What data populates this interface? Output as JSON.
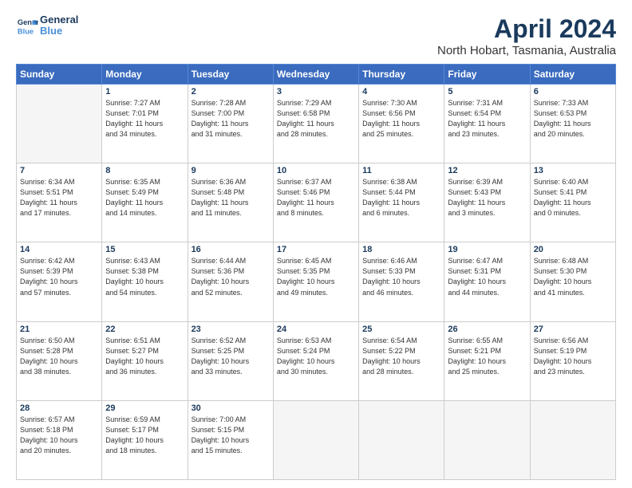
{
  "header": {
    "logo_line1": "General",
    "logo_line2": "Blue",
    "title": "April 2024",
    "subtitle": "North Hobart, Tasmania, Australia"
  },
  "days_of_week": [
    "Sunday",
    "Monday",
    "Tuesday",
    "Wednesday",
    "Thursday",
    "Friday",
    "Saturday"
  ],
  "weeks": [
    [
      {
        "day": "",
        "info": ""
      },
      {
        "day": "1",
        "info": "Sunrise: 7:27 AM\nSunset: 7:01 PM\nDaylight: 11 hours\nand 34 minutes."
      },
      {
        "day": "2",
        "info": "Sunrise: 7:28 AM\nSunset: 7:00 PM\nDaylight: 11 hours\nand 31 minutes."
      },
      {
        "day": "3",
        "info": "Sunrise: 7:29 AM\nSunset: 6:58 PM\nDaylight: 11 hours\nand 28 minutes."
      },
      {
        "day": "4",
        "info": "Sunrise: 7:30 AM\nSunset: 6:56 PM\nDaylight: 11 hours\nand 25 minutes."
      },
      {
        "day": "5",
        "info": "Sunrise: 7:31 AM\nSunset: 6:54 PM\nDaylight: 11 hours\nand 23 minutes."
      },
      {
        "day": "6",
        "info": "Sunrise: 7:33 AM\nSunset: 6:53 PM\nDaylight: 11 hours\nand 20 minutes."
      }
    ],
    [
      {
        "day": "7",
        "info": "Sunrise: 6:34 AM\nSunset: 5:51 PM\nDaylight: 11 hours\nand 17 minutes."
      },
      {
        "day": "8",
        "info": "Sunrise: 6:35 AM\nSunset: 5:49 PM\nDaylight: 11 hours\nand 14 minutes."
      },
      {
        "day": "9",
        "info": "Sunrise: 6:36 AM\nSunset: 5:48 PM\nDaylight: 11 hours\nand 11 minutes."
      },
      {
        "day": "10",
        "info": "Sunrise: 6:37 AM\nSunset: 5:46 PM\nDaylight: 11 hours\nand 8 minutes."
      },
      {
        "day": "11",
        "info": "Sunrise: 6:38 AM\nSunset: 5:44 PM\nDaylight: 11 hours\nand 6 minutes."
      },
      {
        "day": "12",
        "info": "Sunrise: 6:39 AM\nSunset: 5:43 PM\nDaylight: 11 hours\nand 3 minutes."
      },
      {
        "day": "13",
        "info": "Sunrise: 6:40 AM\nSunset: 5:41 PM\nDaylight: 11 hours\nand 0 minutes."
      }
    ],
    [
      {
        "day": "14",
        "info": "Sunrise: 6:42 AM\nSunset: 5:39 PM\nDaylight: 10 hours\nand 57 minutes."
      },
      {
        "day": "15",
        "info": "Sunrise: 6:43 AM\nSunset: 5:38 PM\nDaylight: 10 hours\nand 54 minutes."
      },
      {
        "day": "16",
        "info": "Sunrise: 6:44 AM\nSunset: 5:36 PM\nDaylight: 10 hours\nand 52 minutes."
      },
      {
        "day": "17",
        "info": "Sunrise: 6:45 AM\nSunset: 5:35 PM\nDaylight: 10 hours\nand 49 minutes."
      },
      {
        "day": "18",
        "info": "Sunrise: 6:46 AM\nSunset: 5:33 PM\nDaylight: 10 hours\nand 46 minutes."
      },
      {
        "day": "19",
        "info": "Sunrise: 6:47 AM\nSunset: 5:31 PM\nDaylight: 10 hours\nand 44 minutes."
      },
      {
        "day": "20",
        "info": "Sunrise: 6:48 AM\nSunset: 5:30 PM\nDaylight: 10 hours\nand 41 minutes."
      }
    ],
    [
      {
        "day": "21",
        "info": "Sunrise: 6:50 AM\nSunset: 5:28 PM\nDaylight: 10 hours\nand 38 minutes."
      },
      {
        "day": "22",
        "info": "Sunrise: 6:51 AM\nSunset: 5:27 PM\nDaylight: 10 hours\nand 36 minutes."
      },
      {
        "day": "23",
        "info": "Sunrise: 6:52 AM\nSunset: 5:25 PM\nDaylight: 10 hours\nand 33 minutes."
      },
      {
        "day": "24",
        "info": "Sunrise: 6:53 AM\nSunset: 5:24 PM\nDaylight: 10 hours\nand 30 minutes."
      },
      {
        "day": "25",
        "info": "Sunrise: 6:54 AM\nSunset: 5:22 PM\nDaylight: 10 hours\nand 28 minutes."
      },
      {
        "day": "26",
        "info": "Sunrise: 6:55 AM\nSunset: 5:21 PM\nDaylight: 10 hours\nand 25 minutes."
      },
      {
        "day": "27",
        "info": "Sunrise: 6:56 AM\nSunset: 5:19 PM\nDaylight: 10 hours\nand 23 minutes."
      }
    ],
    [
      {
        "day": "28",
        "info": "Sunrise: 6:57 AM\nSunset: 5:18 PM\nDaylight: 10 hours\nand 20 minutes."
      },
      {
        "day": "29",
        "info": "Sunrise: 6:59 AM\nSunset: 5:17 PM\nDaylight: 10 hours\nand 18 minutes."
      },
      {
        "day": "30",
        "info": "Sunrise: 7:00 AM\nSunset: 5:15 PM\nDaylight: 10 hours\nand 15 minutes."
      },
      {
        "day": "",
        "info": ""
      },
      {
        "day": "",
        "info": ""
      },
      {
        "day": "",
        "info": ""
      },
      {
        "day": "",
        "info": ""
      }
    ]
  ]
}
